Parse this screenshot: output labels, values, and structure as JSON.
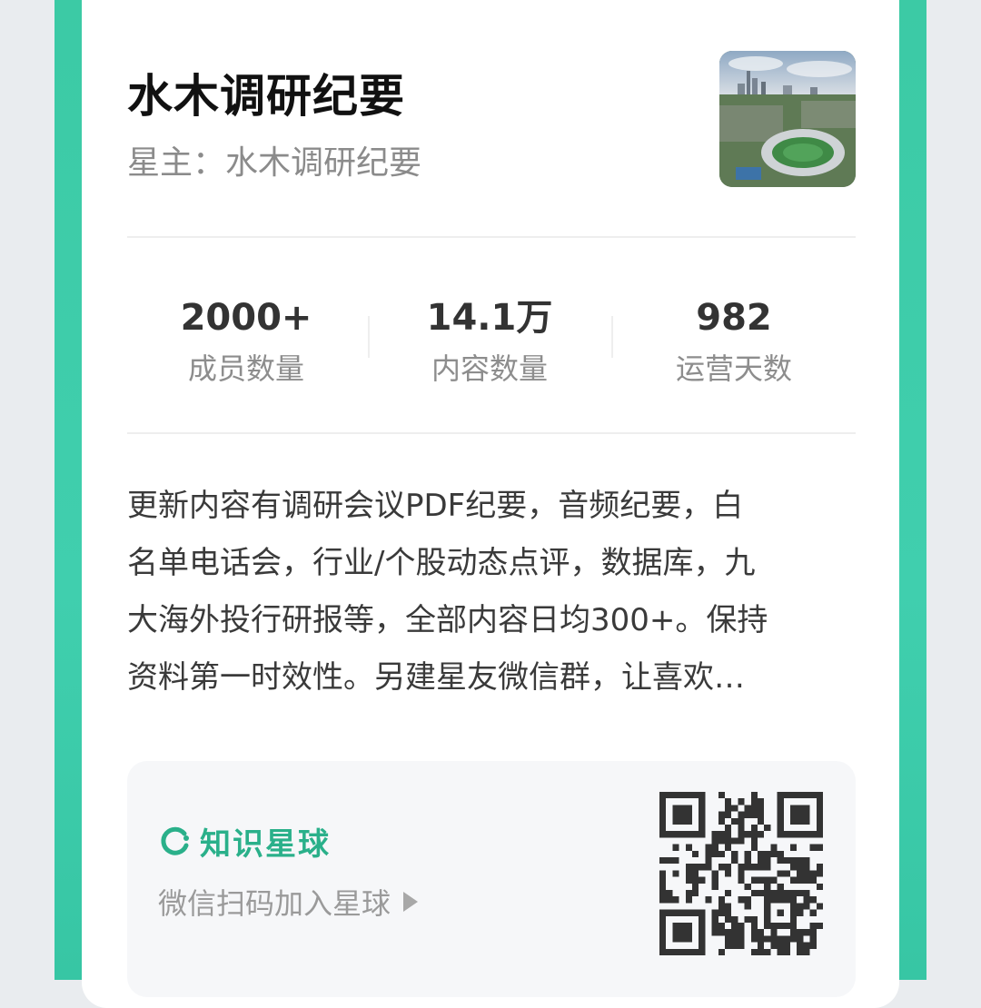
{
  "planet": {
    "title": "水木调研纪要",
    "owner_label": "星主：水木调研纪要",
    "cover_image": "city-stadium-aerial-photo"
  },
  "stats": [
    {
      "value": "2000+",
      "label": "成员数量"
    },
    {
      "value": "14.1万",
      "label": "内容数量"
    },
    {
      "value": "982",
      "label": "运营天数"
    }
  ],
  "description": "更新内容有调研会议PDF纪要，音频纪要，白\n名单电话会，行业/个股动态点评，数据库，九\n大海外投行研报等，全部内容日均300+。保持\n资料第一时效性。另建星友微信群，让喜欢…",
  "join": {
    "brand_name": "知识星球",
    "brand_icon": "zsxq-logo-icon",
    "scan_text": "微信扫码加入星球",
    "qr_icon": "qr-code"
  },
  "colors": {
    "frame": "#3ccaa5",
    "brand": "#2ab08a"
  }
}
